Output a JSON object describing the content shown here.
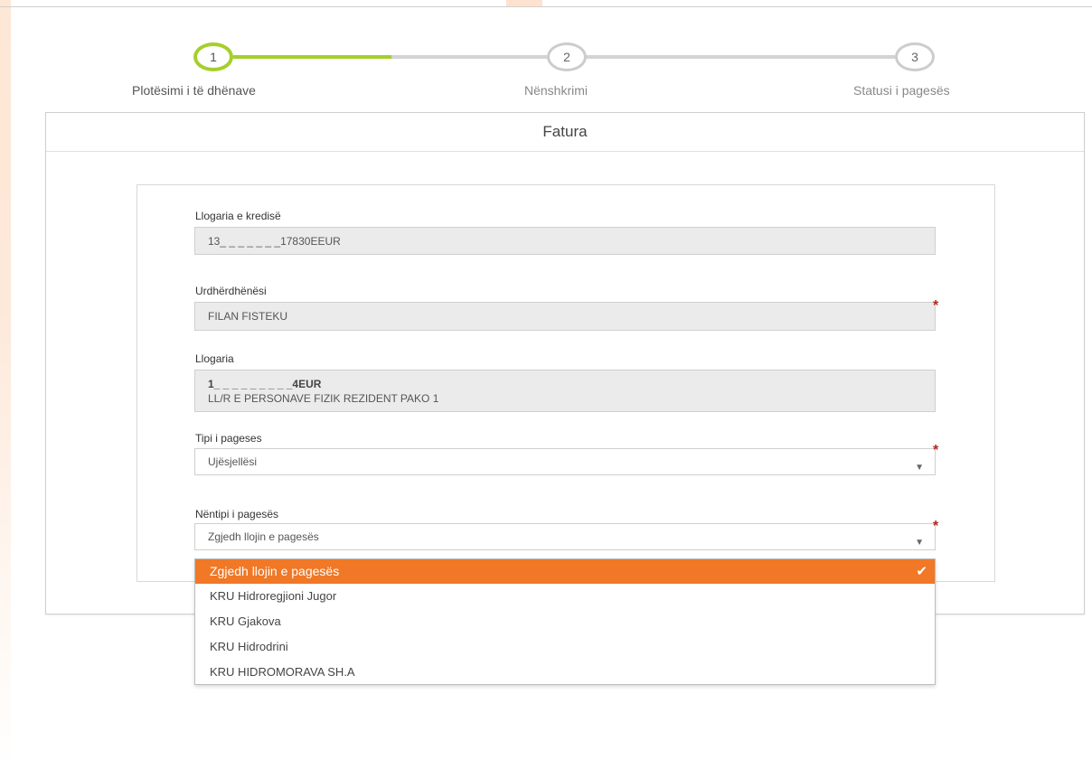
{
  "stepper": {
    "steps": [
      {
        "number": "1",
        "label": "Plotësimi i të dhënave"
      },
      {
        "number": "2",
        "label": "Nënshkrimi"
      },
      {
        "number": "3",
        "label": "Statusi i pagesës"
      }
    ],
    "active_color": "#a5cf2a"
  },
  "card": {
    "title": "Fatura"
  },
  "form": {
    "credit_account": {
      "label": "Llogaria e kredisë",
      "value": "13_ _ _ _ _ _ _17830EEUR"
    },
    "payer": {
      "label": "Urdhërdhënësi",
      "value": "FILAN FISTEKU"
    },
    "account": {
      "label": "Llogaria",
      "value_line1": "1_ _ _ _ _ _ _ _ _4EUR",
      "value_line2": "LL/R E PERSONAVE FIZIK REZIDENT PAKO 1"
    },
    "payment_type": {
      "label": "Tipi i pageses",
      "value": "Ujësjellësi"
    },
    "payment_subtype": {
      "label": "Nëntipi i pagesës",
      "value": "Zgjedh llojin e pagesës"
    }
  },
  "dropdown": {
    "options": [
      "Zgjedh llojin e pagesës",
      "KRU Hidroregjioni Jugor",
      "KRU Gjakova",
      "KRU Hidrodrini",
      "KRU HIDROMORAVA SH.A"
    ],
    "selected_index": 0,
    "highlight_color": "#f07826"
  },
  "icons": {
    "required": "asterisk-icon",
    "caret": "caret-down-icon",
    "check": "check-icon"
  }
}
